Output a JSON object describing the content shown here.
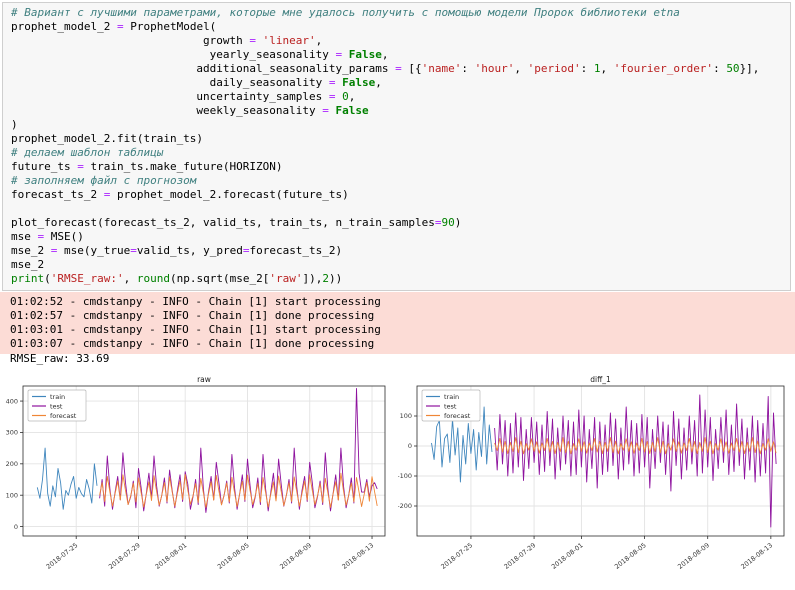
{
  "colors": {
    "cell_bg": "#f7f7f7",
    "cell_border": "#cfcfcf",
    "stderr_bg": "#fcdcd6",
    "train": "#3f86bd",
    "test": "#8e129e",
    "forecast": "#ef8636"
  },
  "cell": {
    "lines": [
      [
        [
          "c",
          "# Вариант с лучшими параметрами, которые мне удалось получить с помощью модели Пророк библиотеки etna"
        ]
      ],
      [
        [
          "p",
          "prophet_model_2 "
        ],
        [
          "o",
          "="
        ],
        [
          "p",
          " ProphetModel("
        ]
      ],
      [
        [
          "p",
          "                             growth "
        ],
        [
          "o",
          "="
        ],
        [
          "p",
          " "
        ],
        [
          "s",
          "'linear'"
        ],
        [
          "p",
          ","
        ]
      ],
      [
        [
          "p",
          "                              yearly_seasonality "
        ],
        [
          "o",
          "="
        ],
        [
          "p",
          " "
        ],
        [
          "k",
          "False"
        ],
        [
          "p",
          ","
        ]
      ],
      [
        [
          "p",
          "                            additional_seasonality_params "
        ],
        [
          "o",
          "="
        ],
        [
          "p",
          " [{"
        ],
        [
          "s",
          "'name'"
        ],
        [
          "p",
          ": "
        ],
        [
          "s",
          "'hour'"
        ],
        [
          "p",
          ", "
        ],
        [
          "s",
          "'period'"
        ],
        [
          "p",
          ": "
        ],
        [
          "n",
          "1"
        ],
        [
          "p",
          ", "
        ],
        [
          "s",
          "'fourier_order'"
        ],
        [
          "p",
          ": "
        ],
        [
          "n",
          "50"
        ],
        [
          "p",
          "}],"
        ]
      ],
      [
        [
          "p",
          "                              daily_seasonality "
        ],
        [
          "o",
          "="
        ],
        [
          "p",
          " "
        ],
        [
          "k",
          "False"
        ],
        [
          "p",
          ","
        ]
      ],
      [
        [
          "p",
          "                            uncertainty_samples "
        ],
        [
          "o",
          "="
        ],
        [
          "p",
          " "
        ],
        [
          "n",
          "0"
        ],
        [
          "p",
          ","
        ]
      ],
      [
        [
          "p",
          "                            weekly_seasonality "
        ],
        [
          "o",
          "="
        ],
        [
          "p",
          " "
        ],
        [
          "k",
          "False"
        ]
      ],
      [
        [
          "p",
          ")"
        ]
      ],
      [
        [
          "p",
          "prophet_model_2.fit(train_ts)"
        ]
      ],
      [
        [
          "c",
          "# делаем шаблон таблицы"
        ]
      ],
      [
        [
          "p",
          "future_ts "
        ],
        [
          "o",
          "="
        ],
        [
          "p",
          " train_ts.make_future(HORIZON)"
        ]
      ],
      [
        [
          "c",
          "# заполняем файл с прогнозом"
        ]
      ],
      [
        [
          "p",
          "forecast_ts_2 "
        ],
        [
          "o",
          "="
        ],
        [
          "p",
          " prophet_model_2.forecast(future_ts)"
        ]
      ],
      [
        [
          "p",
          ""
        ]
      ],
      [
        [
          "p",
          "plot_forecast(forecast_ts_2, valid_ts, train_ts, n_train_samples"
        ],
        [
          "o",
          "="
        ],
        [
          "n",
          "90"
        ],
        [
          "p",
          ")"
        ]
      ],
      [
        [
          "p",
          "mse "
        ],
        [
          "o",
          "="
        ],
        [
          "p",
          " MSE()"
        ]
      ],
      [
        [
          "p",
          "mse_2 "
        ],
        [
          "o",
          "="
        ],
        [
          "p",
          " mse(y_true"
        ],
        [
          "o",
          "="
        ],
        [
          "p",
          "valid_ts, y_pred"
        ],
        [
          "o",
          "="
        ],
        [
          "p",
          "forecast_ts_2)"
        ]
      ],
      [
        [
          "p",
          "mse_2"
        ]
      ],
      [
        [
          "b",
          "print"
        ],
        [
          "p",
          "("
        ],
        [
          "s",
          "'RMSE_raw:'"
        ],
        [
          "p",
          ", "
        ],
        [
          "b",
          "round"
        ],
        [
          "p",
          "(np.sqrt(mse_2["
        ],
        [
          "s",
          "'raw'"
        ],
        [
          "p",
          "]),"
        ],
        [
          "n",
          "2"
        ],
        [
          "p",
          "))"
        ]
      ]
    ]
  },
  "stderr_lines": [
    "01:02:52 - cmdstanpy - INFO - Chain [1] start processing",
    "01:02:57 - cmdstanpy - INFO - Chain [1] done processing",
    "01:03:01 - cmdstanpy - INFO - Chain [1] start processing",
    "01:03:07 - cmdstanpy - INFO - Chain [1] done processing"
  ],
  "stdout_text": "RMSE_raw: 33.69",
  "chart_data": [
    {
      "type": "line",
      "title": "raw",
      "xlabel": "",
      "ylabel": "",
      "grid": true,
      "legend_position": "upper-left",
      "ylim": [
        -30,
        448
      ],
      "yticks": [
        0,
        100,
        200,
        300,
        400
      ],
      "xlim": [
        -5.5,
        134
      ],
      "xticks": [
        {
          "i": 15,
          "label": "2018-07-25"
        },
        {
          "i": 39,
          "label": "2018-07-29"
        },
        {
          "i": 57,
          "label": "2018-08-01"
        },
        {
          "i": 81,
          "label": "2018-08-05"
        },
        {
          "i": 105,
          "label": "2018-08-09"
        },
        {
          "i": 129,
          "label": "2018-08-13"
        }
      ],
      "series": [
        {
          "name": "train",
          "color": "#3f86bd",
          "x0": 0,
          "y": [
            125,
            90,
            150,
            250,
            105,
            65,
            130,
            95,
            185,
            140,
            55,
            115,
            100,
            135,
            160,
            90,
            125,
            105,
            95,
            150,
            120,
            75,
            200,
            130
          ]
        },
        {
          "name": "test",
          "color": "#8e129e",
          "x0": 24,
          "y": [
            90,
            150,
            65,
            225,
            120,
            55,
            110,
            160,
            85,
            235,
            140,
            70,
            95,
            145,
            60,
            185,
            125,
            50,
            105,
            170,
            90,
            225,
            130,
            65,
            100,
            155,
            75,
            180,
            115,
            60,
            115,
            165,
            80,
            175,
            135,
            55,
            95,
            150,
            70,
            250,
            120,
            45,
            110,
            160,
            85,
            205,
            140,
            70,
            100,
            145,
            75,
            230,
            125,
            55,
            105,
            165,
            80,
            215,
            130,
            60,
            95,
            155,
            70,
            230,
            120,
            50,
            110,
            170,
            85,
            215,
            135,
            65,
            100,
            150,
            75,
            250,
            125,
            55,
            115,
            160,
            80,
            205,
            140,
            60,
            95,
            145,
            70,
            235,
            120,
            50,
            105,
            165,
            85,
            250,
            130,
            60,
            100,
            155,
            75,
            440,
            170,
            110,
            110,
            150,
            95,
            130,
            140,
            120
          ]
        },
        {
          "name": "forecast",
          "color": "#ef8636",
          "x0": 24,
          "y": [
            100,
            140,
            80,
            160,
            110,
            65,
            105,
            145,
            85,
            165,
            115,
            70,
            98,
            138,
            78,
            155,
            108,
            62,
            103,
            142,
            83,
            162,
            112,
            68,
            100,
            140,
            80,
            158,
            110,
            65,
            106,
            146,
            86,
            166,
            116,
            71,
            98,
            137,
            77,
            154,
            107,
            61,
            104,
            143,
            84,
            163,
            113,
            69,
            100,
            139,
            79,
            157,
            109,
            64,
            105,
            144,
            85,
            164,
            114,
            70,
            98,
            138,
            78,
            156,
            108,
            62,
            103,
            142,
            82,
            161,
            112,
            67,
            100,
            140,
            80,
            158,
            110,
            65,
            105,
            145,
            85,
            165,
            115,
            70,
            98,
            137,
            77,
            154,
            107,
            61,
            104,
            143,
            84,
            170,
            113,
            68,
            100,
            139,
            79,
            156,
            109,
            64,
            103,
            141,
            81,
            159,
            111,
            66
          ]
        }
      ]
    },
    {
      "type": "line",
      "title": "diff_1",
      "xlabel": "",
      "ylabel": "",
      "grid": true,
      "legend_position": "upper-left",
      "ylim": [
        -300,
        200
      ],
      "yticks": [
        -200,
        -100,
        0,
        100
      ],
      "xlim": [
        -5.5,
        134
      ],
      "xticks": [
        {
          "i": 15,
          "label": "2018-07-25"
        },
        {
          "i": 39,
          "label": "2018-07-29"
        },
        {
          "i": 57,
          "label": "2018-08-01"
        },
        {
          "i": 81,
          "label": "2018-08-05"
        },
        {
          "i": 105,
          "label": "2018-08-09"
        },
        {
          "i": 129,
          "label": "2018-08-13"
        }
      ],
      "series": [
        {
          "name": "train",
          "color": "#3f86bd",
          "x0": 0,
          "y": [
            10,
            -45,
            65,
            85,
            -70,
            25,
            40,
            -55,
            90,
            -30,
            60,
            -120,
            35,
            -60,
            75,
            -25,
            55,
            -80,
            45,
            -35,
            130,
            -60,
            70,
            -20
          ]
        },
        {
          "name": "test",
          "color": "#8e129e",
          "x0": 24,
          "y": [
            60,
            -80,
            105,
            -60,
            85,
            -100,
            75,
            -90,
            110,
            -70,
            95,
            -115,
            55,
            -75,
            95,
            -55,
            80,
            -95,
            70,
            -85,
            115,
            -65,
            90,
            -110,
            60,
            -80,
            100,
            -60,
            85,
            -100,
            80,
            -95,
            120,
            -70,
            100,
            -120,
            55,
            -75,
            95,
            -140,
            80,
            -95,
            70,
            -85,
            110,
            -65,
            90,
            -110,
            60,
            -80,
            130,
            -60,
            85,
            -100,
            75,
            -90,
            105,
            -70,
            95,
            -140,
            55,
            -75,
            100,
            -55,
            80,
            -95,
            70,
            -150,
            115,
            -65,
            90,
            -110,
            60,
            -80,
            100,
            -60,
            85,
            -100,
            170,
            -90,
            120,
            -70,
            95,
            -115,
            55,
            -75,
            95,
            -55,
            120,
            -95,
            70,
            -85,
            140,
            -65,
            90,
            -110,
            60,
            -80,
            100,
            -120,
            85,
            -100,
            75,
            -90,
            165,
            -270,
            110,
            -60
          ]
        },
        {
          "name": "forecast",
          "color": "#ef8636",
          "x0": 24,
          "y": [
            10,
            -15,
            25,
            -20,
            15,
            -25,
            12,
            -18,
            28,
            -22,
            16,
            -26,
            8,
            -14,
            24,
            -18,
            14,
            -24,
            10,
            -15,
            25,
            -20,
            15,
            -25,
            12,
            -18,
            28,
            -22,
            16,
            -26,
            8,
            -14,
            24,
            -18,
            14,
            -24,
            10,
            -15,
            25,
            -20,
            15,
            -25,
            12,
            -18,
            28,
            -22,
            16,
            -26,
            8,
            -14,
            24,
            -18,
            14,
            -24,
            10,
            -15,
            25,
            -20,
            15,
            -25,
            12,
            -18,
            28,
            -22,
            16,
            -26,
            8,
            -14,
            24,
            -18,
            14,
            -24,
            10,
            -15,
            25,
            -20,
            15,
            -25,
            12,
            -18,
            28,
            -22,
            16,
            -26,
            8,
            -14,
            24,
            -18,
            14,
            -24,
            10,
            -15,
            25,
            -20,
            15,
            -25,
            12,
            -18,
            28,
            -22,
            16,
            -26,
            8,
            -14,
            24,
            -18,
            14,
            -24
          ]
        }
      ]
    }
  ]
}
